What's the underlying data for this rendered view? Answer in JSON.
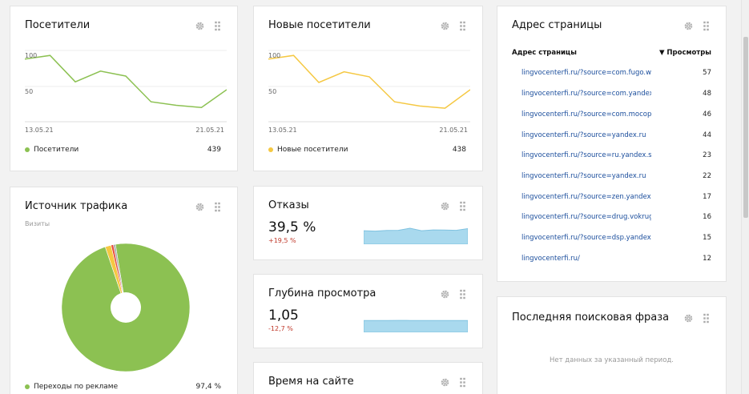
{
  "visitors": {
    "title": "Посетители",
    "ytick_high": "100",
    "ytick_mid": "50",
    "x_start": "13.05.21",
    "x_end": "21.05.21",
    "legend_label": "Посетители",
    "total": "439",
    "color": "#8cc152"
  },
  "new_visitors": {
    "title": "Новые посетители",
    "ytick_high": "100",
    "ytick_mid": "50",
    "x_start": "13.05.21",
    "x_end": "21.05.21",
    "legend_label": "Новые посетители",
    "total": "438",
    "color": "#f5c842"
  },
  "traffic_source": {
    "title": "Источник трафика",
    "subtitle": "Визиты",
    "legend_label": "Переходы по рекламе",
    "legend_value": "97,4 %",
    "color": "#8cc152"
  },
  "bounces": {
    "title": "Отказы",
    "value": "39,5 %",
    "change": "+19,5 %"
  },
  "depth": {
    "title": "Глубина просмотра",
    "value": "1,05",
    "change": "-12,7 %"
  },
  "time_on_site": {
    "title": "Время на сайте"
  },
  "page_address": {
    "title": "Адрес страницы",
    "col_url": "Адрес страницы",
    "col_views": "▼ Просмотры",
    "rows": [
      {
        "url": "lingvocenterfi.ru/?source=com.fugo.wow",
        "views": "57"
      },
      {
        "url": "lingvocenterfi.ru/?source=com.yandex.browser",
        "views": "48"
      },
      {
        "url": "lingvocenterfi.ru/?source=com.mocoplex",
        "views": "46"
      },
      {
        "url": "lingvocenterfi.ru/?source=yandex.ru",
        "views": "44"
      },
      {
        "url": "lingvocenterfi.ru/?source=ru.yandex.searchplugin",
        "views": "23"
      },
      {
        "url": "lingvocenterfi.ru/?source=yandex.ru",
        "views": "22"
      },
      {
        "url": "lingvocenterfi.ru/?source=zen.yandex.ru",
        "views": "17"
      },
      {
        "url": "lingvocenterfi.ru/?source=drug.vokrug",
        "views": "16"
      },
      {
        "url": "lingvocenterfi.ru/?source=dsp.yandex.ru",
        "views": "15"
      },
      {
        "url": "lingvocenterfi.ru/",
        "views": "12"
      }
    ]
  },
  "last_search_phrase": {
    "title": "Последняя поисковая фраза",
    "empty_message": "Нет данных за указанный период."
  },
  "chart_data": [
    {
      "type": "line",
      "series": [
        {
          "name": "Посетители",
          "values": [
            88,
            93,
            56,
            71,
            64,
            28,
            23,
            20,
            45
          ]
        }
      ],
      "x": [
        "13.05.21",
        "",
        "",
        "",
        "",
        "",
        "",
        "",
        "21.05.21"
      ],
      "ylim": [
        0,
        100
      ],
      "xlabel": "",
      "ylabel": ""
    },
    {
      "type": "line",
      "series": [
        {
          "name": "Новые посетители",
          "values": [
            88,
            93,
            55,
            70,
            63,
            28,
            22,
            19,
            45
          ]
        }
      ],
      "x": [
        "13.05.21",
        "",
        "",
        "",
        "",
        "",
        "",
        "",
        "21.05.21"
      ],
      "ylim": [
        0,
        100
      ],
      "xlabel": "",
      "ylabel": ""
    },
    {
      "type": "pie",
      "slices": [
        {
          "label": "Переходы по рекламе",
          "value": 97.4,
          "color": "#8cc152"
        },
        {
          "label": "",
          "value": 1.5,
          "color": "#f5c842"
        },
        {
          "label": "",
          "value": 0.6,
          "color": "#e74c3c"
        },
        {
          "label": "",
          "value": 0.5,
          "color": "#aaaaaa"
        }
      ]
    },
    {
      "type": "area",
      "series": [
        {
          "name": "Отказы",
          "values": [
            40,
            38,
            41,
            42,
            52,
            40,
            44,
            43,
            42,
            50
          ]
        }
      ],
      "ylim": [
        0,
        60
      ]
    },
    {
      "type": "area",
      "series": [
        {
          "name": "Глубина просмотра",
          "values": [
            1.05,
            1.06,
            1.05,
            1.07,
            1.06,
            1.05,
            1.06,
            1.05,
            1.06,
            1.04
          ]
        }
      ],
      "ylim": [
        0,
        1.5
      ]
    }
  ]
}
